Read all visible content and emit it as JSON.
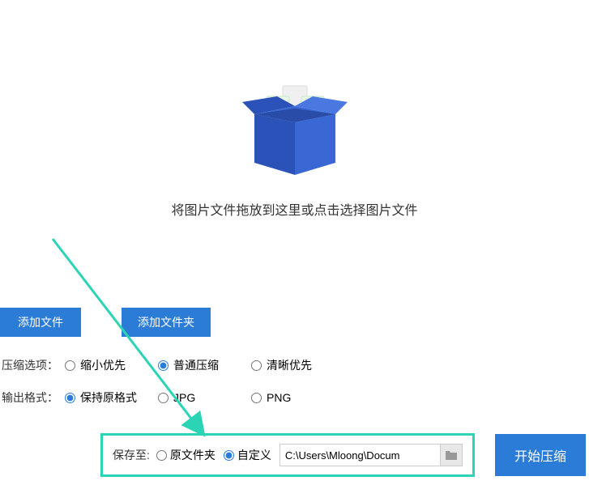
{
  "dropArea": {
    "text": "将图片文件拖放到这里或点击选择图片文件"
  },
  "buttons": {
    "addFile": "添加文件",
    "addFolder": "添加文件夹"
  },
  "compressOption": {
    "label": "压缩选项：",
    "option1": "缩小优先",
    "option2": "普通压缩",
    "option3": "清晰优先"
  },
  "outputFormat": {
    "label": "输出格式：",
    "option1": "保持原格式",
    "option2": "JPG",
    "option3": "PNG"
  },
  "saveTo": {
    "label": "保存至:",
    "option1": "原文件夹",
    "option2": "自定义",
    "path": "C:\\Users\\Mloong\\Docum"
  },
  "startButton": "开始压缩"
}
